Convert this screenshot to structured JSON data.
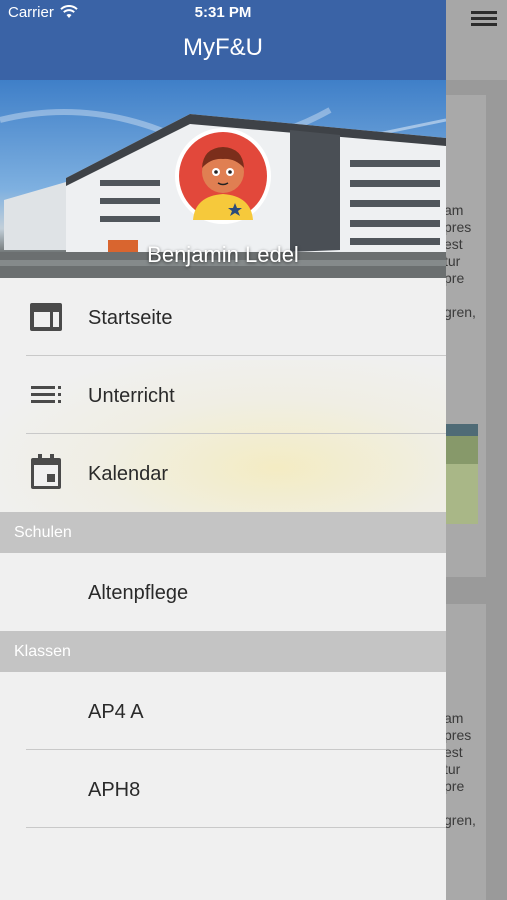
{
  "status_bar": {
    "carrier": "Carrier",
    "time": "5:31 PM"
  },
  "navbar": {
    "title": "MyF&U"
  },
  "user": {
    "name": "Benjamin Ledel"
  },
  "menu": {
    "main_items": [
      {
        "label": "Startseite",
        "icon": "dashboard-icon"
      },
      {
        "label": "Unterricht",
        "icon": "list-icon"
      },
      {
        "label": "Kalendar",
        "icon": "calendar-icon"
      }
    ],
    "schools_header": "Schulen",
    "schools": [
      {
        "label": "Altenpflege"
      }
    ],
    "classes_header": "Klassen",
    "classes": [
      {
        "label": "AP4 A"
      },
      {
        "label": "APH8"
      }
    ]
  },
  "background": {
    "card1_text": "am\npres\nest\ntur\npre\n\ngren,",
    "card2_text": "am\npres\nest\ntur\npre\n\ngren,"
  },
  "colors": {
    "navbar": "#3a63a6",
    "avatar_bg": "#e2483b",
    "section_header": "#c4c4c4"
  }
}
